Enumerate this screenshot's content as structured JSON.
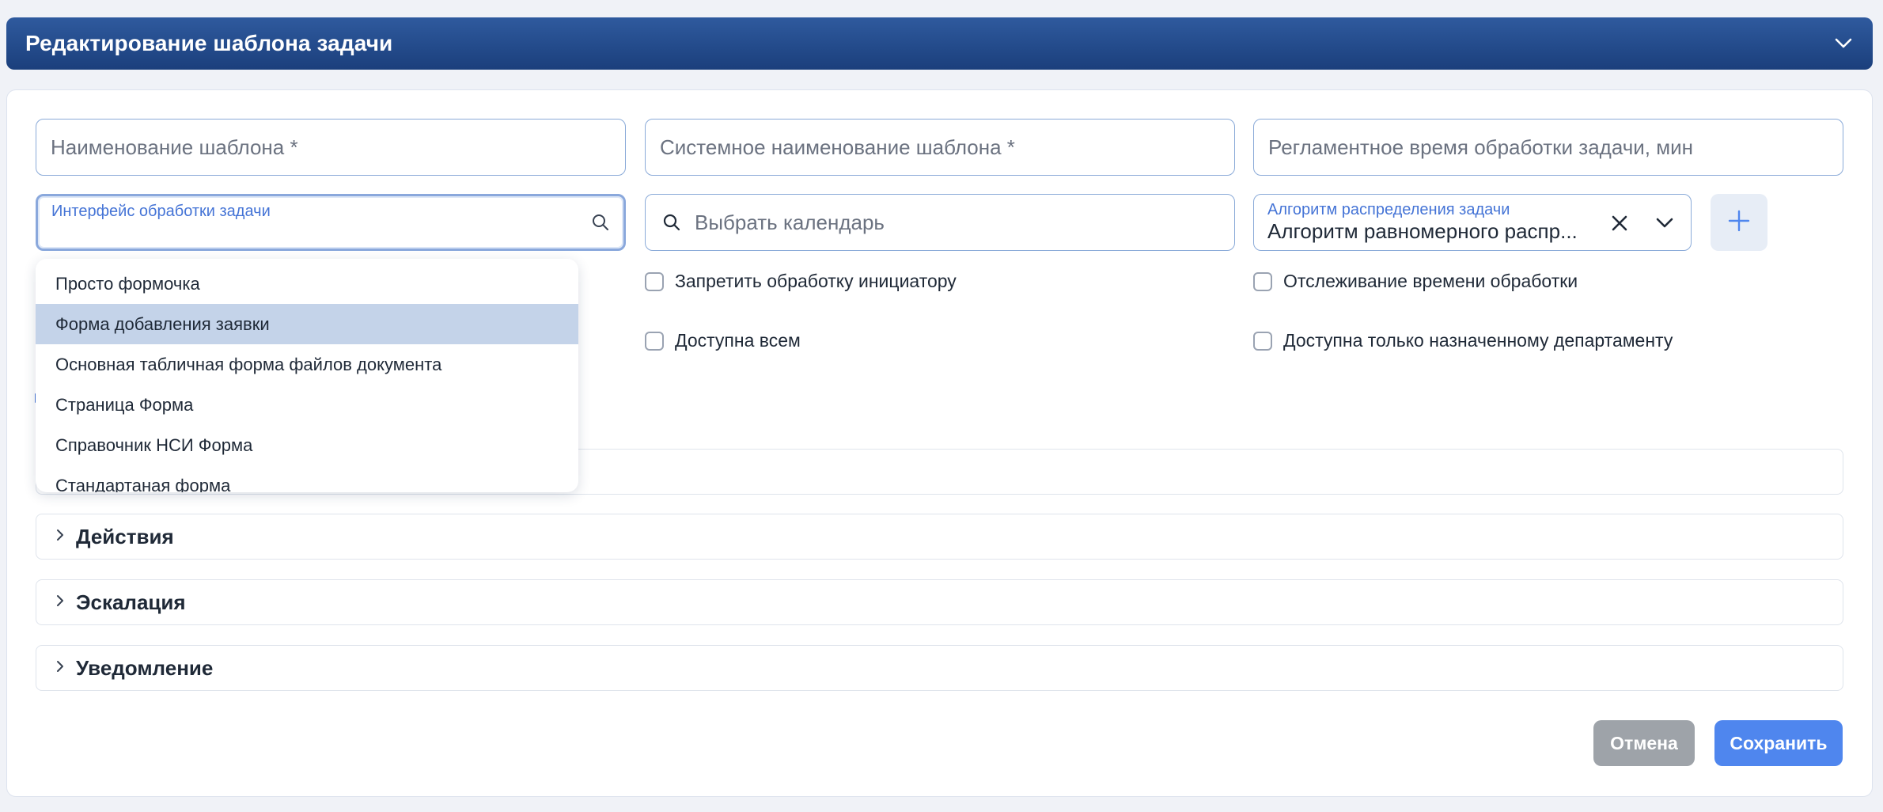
{
  "header": {
    "title": "Редактирование шаблона задачи"
  },
  "fields": {
    "template_name_placeholder": "Наименование шаблона *",
    "system_name_placeholder": "Системное наименование шаблона *",
    "regulated_time_placeholder": "Регламентное время обработки задачи, мин",
    "interface_label": "Интерфейс обработки задачи",
    "calendar_placeholder": "Выбрать календарь",
    "algorithm_label": "Алгоритм распределения задачи",
    "algorithm_value": "Алгоритм равномерного распр..."
  },
  "checkboxes": {
    "forbid_initiator": "Запретить обработку инициатору",
    "time_tracking": "Отслеживание времени обработки",
    "available_all": "Доступна всем",
    "available_department": "Доступна только назначенному департаменту"
  },
  "dropdown": {
    "items": [
      "Просто формочка",
      "Форма добавления заявки",
      "Основная табличная форма файлов документа",
      "Страница Форма",
      "Справочник НСИ Форма",
      "Стандартаная форма"
    ],
    "selected": "Форма добавления заявки"
  },
  "sections": {
    "actions": "Действия",
    "escalation": "Эскалация",
    "notification": "Уведомление"
  },
  "buttons": {
    "cancel": "Отмена",
    "save": "Сохранить"
  },
  "colors": {
    "header_bg": "#1b3f7c",
    "accent": "#4f86ee",
    "selected_item": "#c4d3e9",
    "cancel_bg": "#9ea3a9"
  },
  "icons": {
    "header": "chevron-down-icon",
    "interface": "search-icon",
    "calendar": "search-icon",
    "algorithm_clear": "close-icon",
    "algorithm_toggle": "chevron-down-icon",
    "add": "plus-icon",
    "section": "chevron-right-icon"
  }
}
